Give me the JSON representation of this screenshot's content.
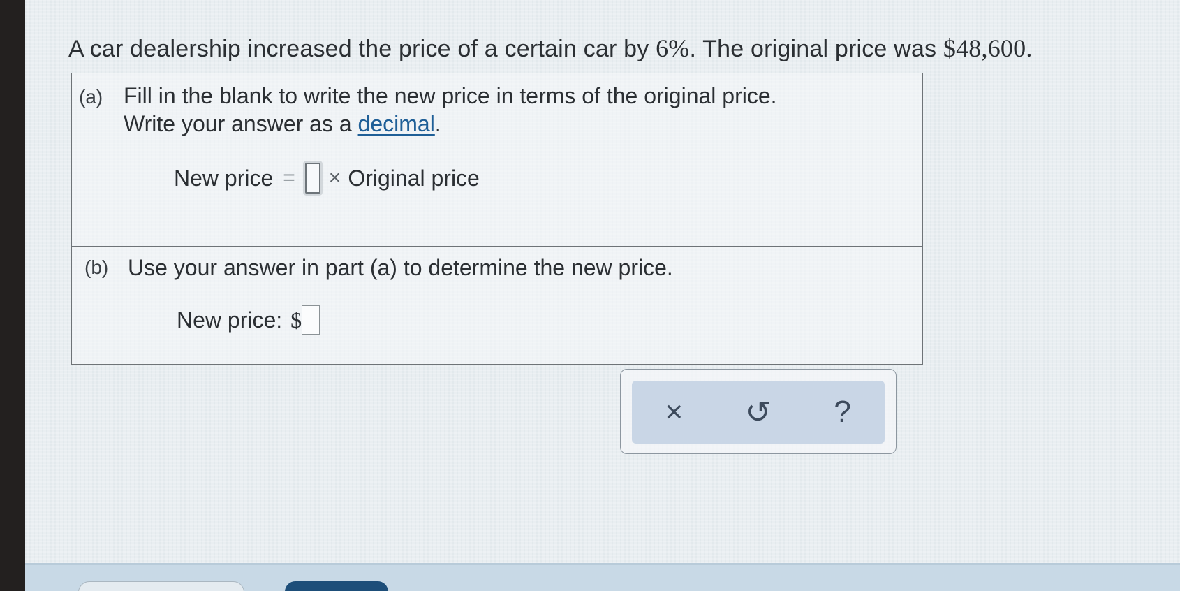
{
  "question": {
    "prefix": "A car dealership increased the price of a certain car by ",
    "percent": "6%",
    "middle": ". The original price was ",
    "price": "$48,600",
    "suffix": "."
  },
  "part_a": {
    "label": "(a)",
    "line1": "Fill in the blank to write the new price in terms of the original price.",
    "line2_prefix": "Write your answer as a ",
    "line2_link": "decimal",
    "line2_suffix": ".",
    "eq_left": "New price",
    "eq_sign": "=",
    "times": "×",
    "eq_right": "Original price",
    "blank_value": ""
  },
  "part_b": {
    "label": "(b)",
    "text": "Use your answer in part (a) to determine the new price.",
    "prompt": "New price:",
    "currency": "$",
    "blank_value": ""
  },
  "toolbar": {
    "clear_icon": "×",
    "undo_icon": "↺",
    "help_icon": "?"
  }
}
